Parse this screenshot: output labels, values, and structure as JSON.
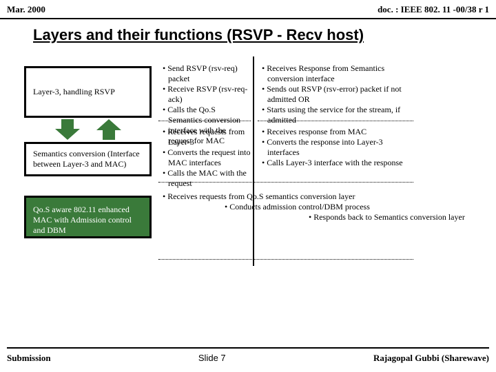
{
  "header": {
    "date": "Mar. 2000",
    "docid": "doc. : IEEE 802. 11 -00/38 r 1"
  },
  "title": "Layers and their functions (RSVP - Recv host)",
  "boxes": {
    "layer3": "Layer-3, handling RSVP",
    "semconv": "Semantics conversion (Interface between Layer-3 and MAC)",
    "mac": "Qo.S aware 802.11 enhanced MAC with Admission control and DBM"
  },
  "row1": {
    "left": [
      "Send RSVP (rsv-req) packet",
      "Receive RSVP (rsv-req-ack)",
      "Calls the Qo.S Semantics conversion interface with the request for MAC"
    ],
    "right": [
      "Receives Response from Semantics conversion interface",
      "Sends out RSVP (rsv-error) packet if not admitted OR",
      "Starts using the service for the stream, if admitted"
    ]
  },
  "row2": {
    "left": [
      "Receives requests from Layer-3",
      "Converts the request into MAC interfaces",
      "Calls the MAC with the request"
    ],
    "right": [
      "Receives response from MAC",
      "Converts the response into Layer-3 interfaces",
      "Calls Layer-3 interface with the response"
    ]
  },
  "row3": {
    "a": "Receives requests from Qo.S semantics conversion layer",
    "b": "Conducts admission control/DBM process",
    "c": "Responds back to Semantics conversion layer"
  },
  "footer": {
    "left": "Submission",
    "slide": "Slide 7",
    "right": "Rajagopal Gubbi (Sharewave)"
  }
}
